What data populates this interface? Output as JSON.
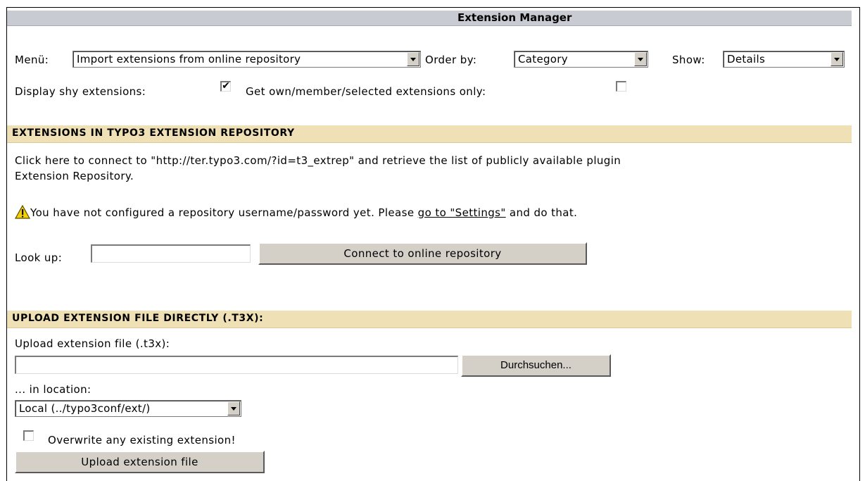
{
  "header": {
    "title": "Extension Manager"
  },
  "toolbar": {
    "menu_label": "Menü:",
    "menu_value": "Import extensions from online repository",
    "order_label": "Order by:",
    "order_value": "Category",
    "show_label": "Show:",
    "show_value": "Details",
    "shy_label": "Display shy extensions:",
    "shy_checked": "✔",
    "own_label": "Get own/member/selected extensions only:"
  },
  "repository": {
    "heading": "EXTENSIONS IN TYPO3 EXTENSION REPOSITORY",
    "description_line1": "Click here to connect to \"http://ter.typo3.com/?id=t3_extrep\" and retrieve the list of publicly available plugin",
    "description_line2": "Extension Repository.",
    "warning_text": "You have not configured a repository username/password yet. Please ",
    "warning_link": "go to \"Settings\"",
    "warning_suffix": " and do that.",
    "lookup_label": "Look up:",
    "lookup_value": "",
    "connect_button": "Connect to online repository"
  },
  "upload": {
    "heading": "UPLOAD EXTENSION FILE DIRECTLY (.T3X):",
    "file_label": "Upload extension file (.t3x):",
    "file_value": "",
    "browse_button": "Durchsuchen...",
    "location_label": "... in location:",
    "location_value": "Local (../typo3conf/ext/)",
    "overwrite_label": "Overwrite any existing extension!",
    "upload_button": "Upload extension file"
  },
  "colors": {
    "title_bar": "#c9cbd3",
    "section_bar": "#efe0b6",
    "button_face": "#d4d0c8",
    "warning_icon": "#f5d000"
  }
}
